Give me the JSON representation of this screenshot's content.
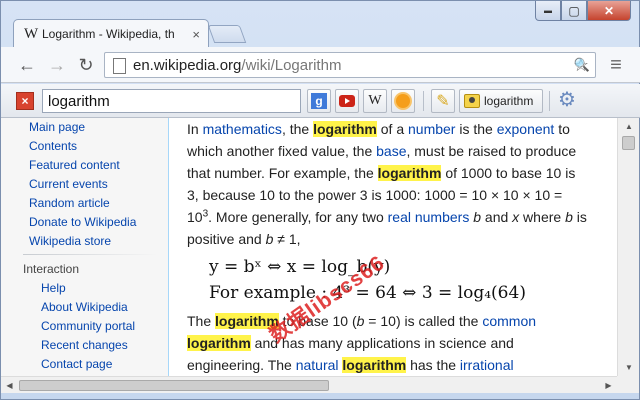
{
  "window": {
    "controls": {
      "minimize": "▬",
      "maximize": "▢",
      "close": "✕"
    }
  },
  "tab": {
    "favicon": "W",
    "title": "Logarithm - Wikipedia, th",
    "close": "×"
  },
  "toolbar": {
    "back": "←",
    "forward": "→",
    "reload": "↻",
    "url_host": "en.wikipedia.org",
    "url_path": "/wiki/Logarithm",
    "star": "☆",
    "search_icon": "🔍",
    "menu_icon": "≡"
  },
  "extension_bar": {
    "close": "×",
    "query": "logarithm",
    "google_label": "g",
    "wiki_label": "W",
    "pen_icon": "✎",
    "highlight_label": "logarithm",
    "gear_icon": "⚙"
  },
  "sidebar": {
    "navigation": [
      "Main page",
      "Contents",
      "Featured content",
      "Current events",
      "Random article",
      "Donate to Wikipedia",
      "Wikipedia store"
    ],
    "interaction_heading": "Interaction",
    "interaction": [
      "Help",
      "About Wikipedia",
      "Community portal",
      "Recent changes",
      "Contact page"
    ]
  },
  "article": {
    "p1": {
      "t1": "In ",
      "l1": "mathematics",
      "t2": ", the ",
      "h1": "logarithm",
      "t3": " of a ",
      "l2": "number",
      "t4": " is the ",
      "l3": "exponent",
      "t5": " to which another fixed value, the ",
      "l4": "base",
      "t6": ", must be raised to produce that number. For example, the ",
      "h2": "logarithm",
      "t7": " of 1000 to base 10 is 3, because 10 to the power 3 is 1000: 1000 = 10 × 10 × 10 = 10",
      "sup": "3",
      "t8": ". More generally, for any two ",
      "l5": "real numbers",
      "t9": " ",
      "v1": "b",
      "t10": " and ",
      "v2": "x",
      "t11": " where ",
      "v3": "b",
      "t12": " is positive and ",
      "v4": "b",
      "t13": " ≠ 1,"
    },
    "math1": "y = bˣ ⇔ x = log_b(y)",
    "math2": "For example : 4³ = 64 ⇔ 3 = log₄(64)",
    "p2": {
      "t1": "The ",
      "h1": "logarithm",
      "t2": " to base 10 (",
      "v1": "b",
      "t3": " = 10) is called the ",
      "l1": "common",
      "h2": "logarithm",
      "t4": " and has many applications in science and engineering. The ",
      "l2": "natural",
      "t5": " ",
      "h3": "logarithm",
      "t6": " has the ",
      "l3": "irrational"
    }
  },
  "watermark": "数据libscs66",
  "colors": {
    "link": "#0645ad",
    "highlight": "#fff34a",
    "close_button": "#c5442e"
  }
}
